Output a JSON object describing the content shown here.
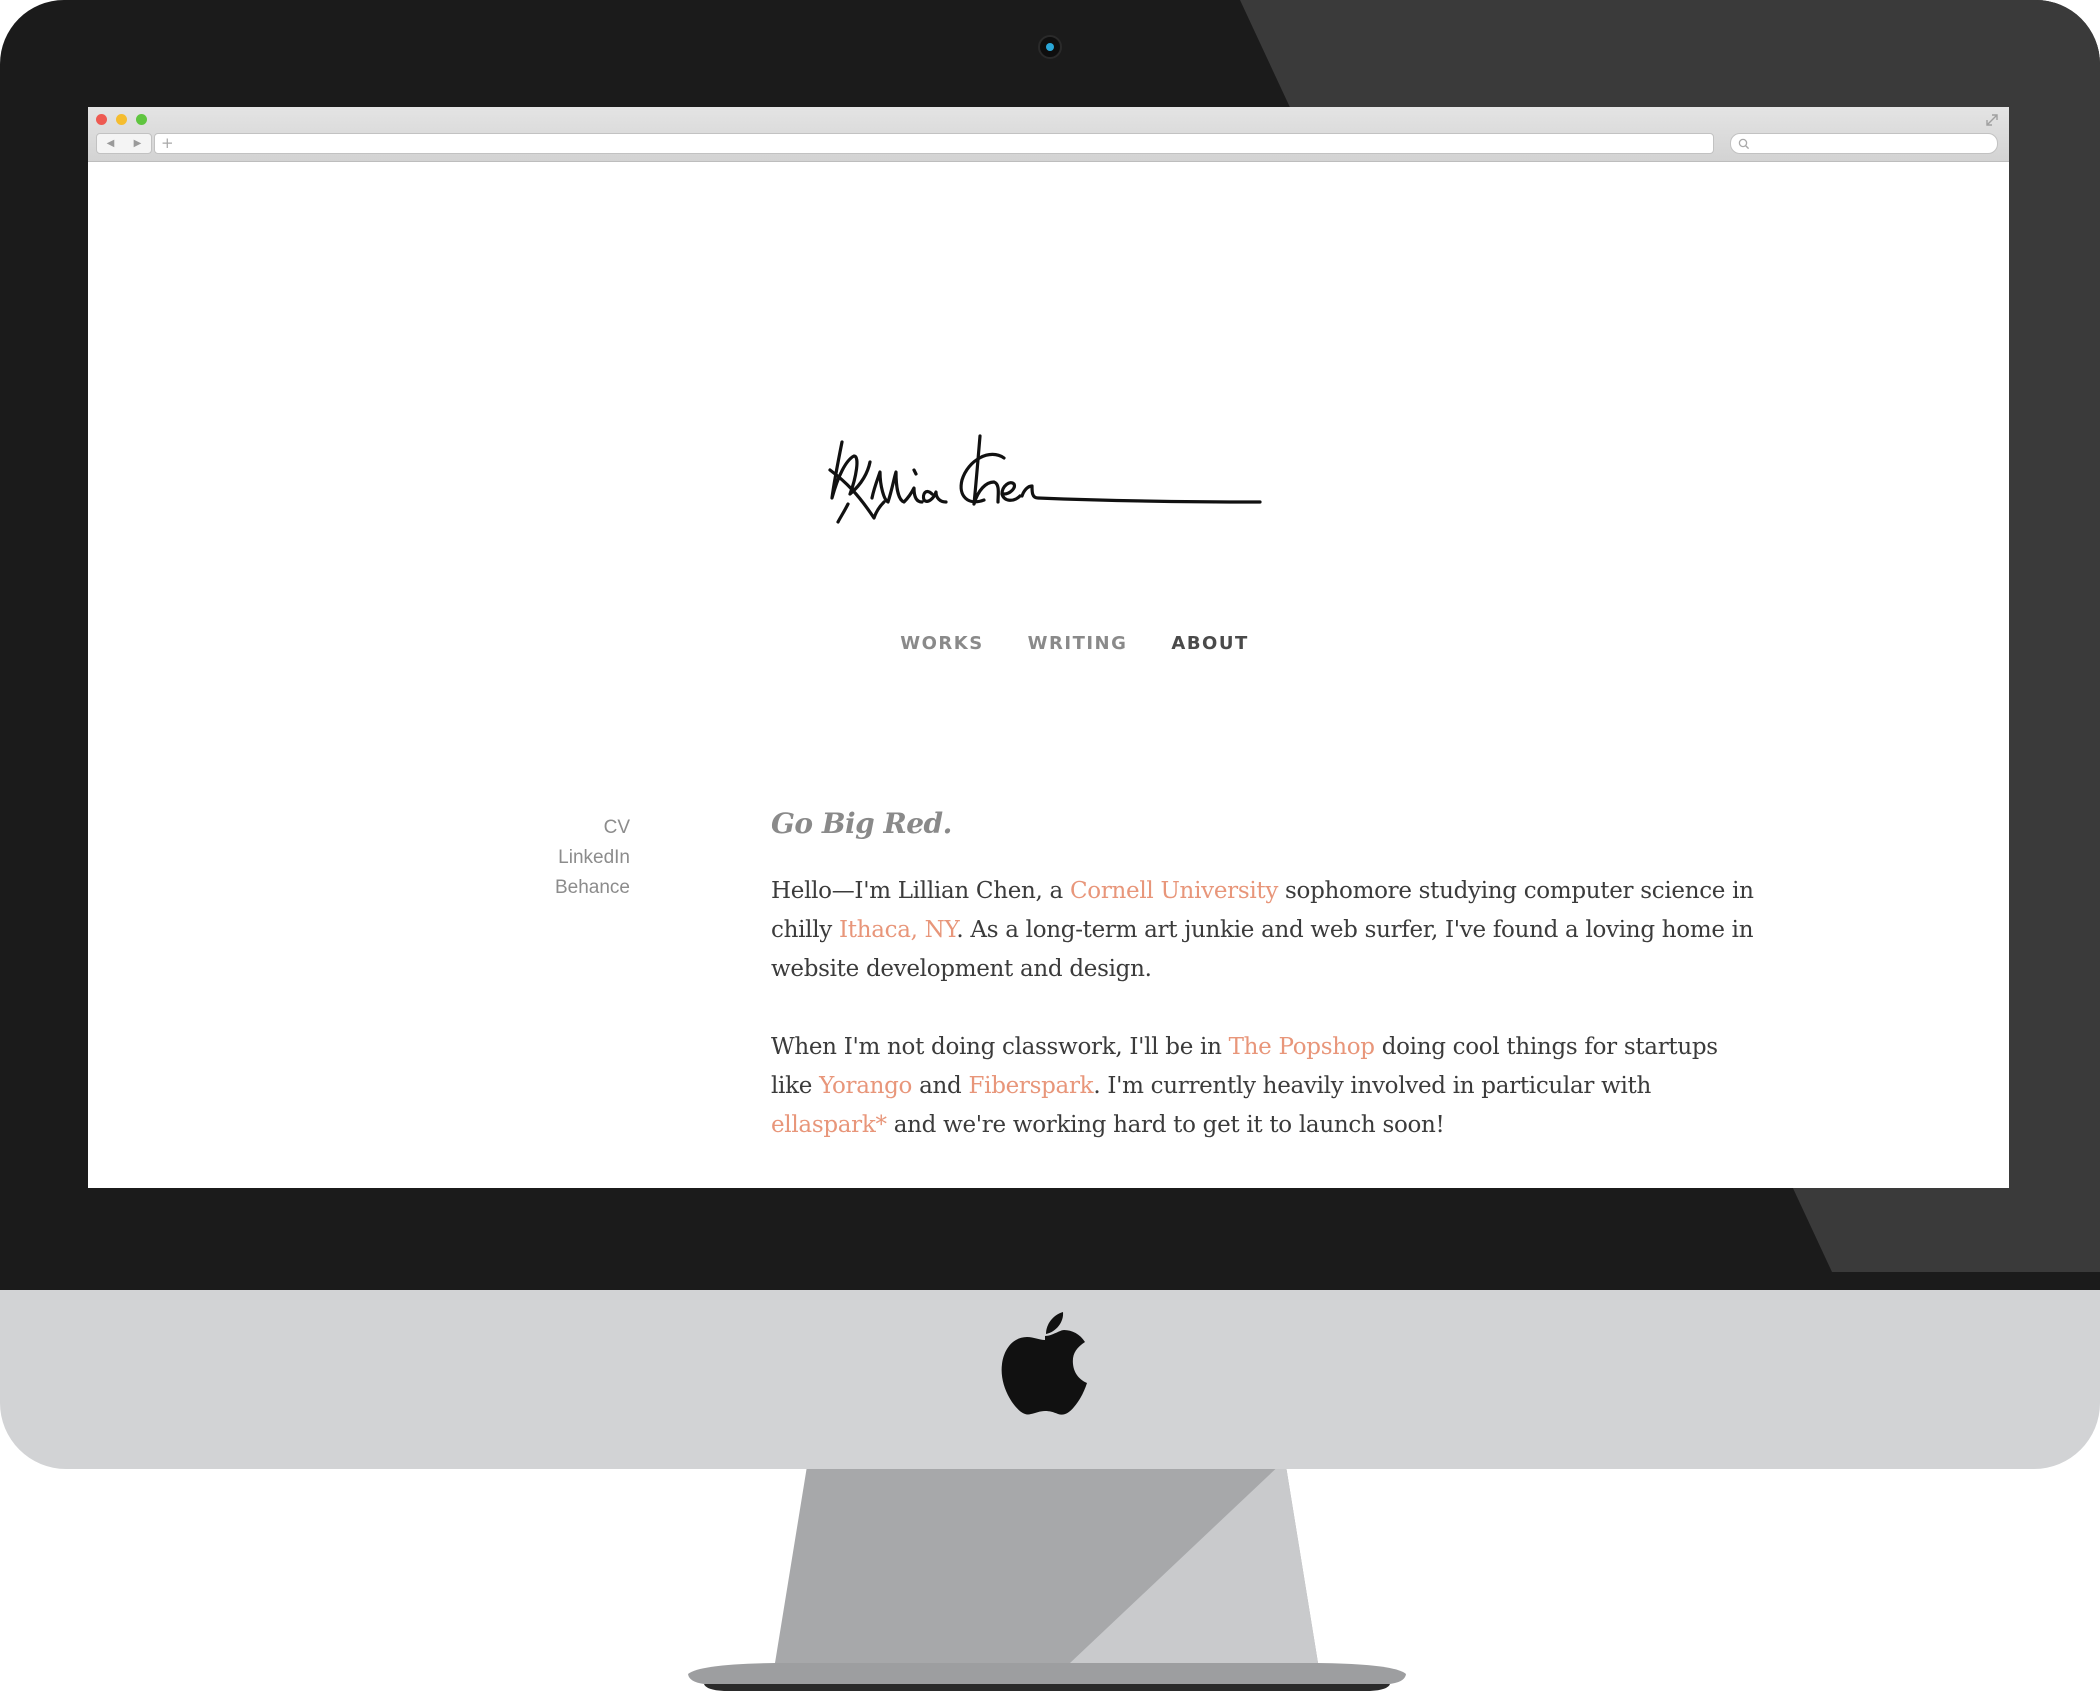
{
  "colors": {
    "monitor_bezel": "#1b1b1b",
    "monitor_chin": "#d2d3d5",
    "link_accent": "#e8967a",
    "body_text": "#3b3b3b",
    "muted_text": "#8a8a8a"
  },
  "browser": {
    "back_glyph": "◀",
    "forward_glyph": "▶",
    "new_tab_glyph": "+",
    "url_value": "",
    "search_value": ""
  },
  "site": {
    "signature_text": "Lillian Chen",
    "nav": [
      {
        "label": "WORKS",
        "active": false
      },
      {
        "label": "WRITING",
        "active": false
      },
      {
        "label": "ABOUT",
        "active": true
      }
    ],
    "side_links": [
      "CV",
      "LinkedIn",
      "Behance"
    ],
    "tagline": "Go Big Red.",
    "para1": {
      "t1": "Hello—I'm Lillian Chen, a ",
      "l1": "Cornell University",
      "t2": " sophomore studying computer science in chilly ",
      "l2": "Ithaca, NY",
      "t3": ". As a long-term art junkie and web surfer, I've found a loving home in website development and design."
    },
    "para2": {
      "t1": "When I'm not doing classwork, I'll be in ",
      "l1": "The Popshop",
      "t2": " doing cool things for startups like ",
      "l2": "Yorango",
      "t3": " and ",
      "l3": "Fiberspark",
      "t4": ". I'm currently heavily involved in particular with ",
      "l4": "ellaspark*",
      "t5": " and we're working hard to get it to launch soon!"
    }
  },
  "icons": {
    "camera": "camera-icon",
    "apple_logo": "apple-logo-icon",
    "search": "search-icon",
    "expand": "expand-icon"
  }
}
